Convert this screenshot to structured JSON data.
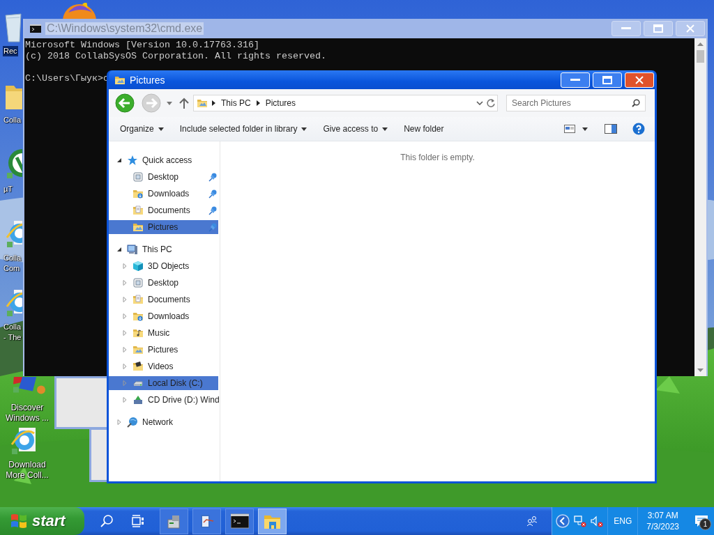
{
  "desktop": {
    "icons": [
      {
        "label_lines": [
          "Rec"
        ],
        "selected": true,
        "kind": "bin"
      },
      {
        "label_lines": [
          "Colla"
        ],
        "selected": false,
        "kind": "folder"
      },
      {
        "label_lines": [
          "µT"
        ],
        "selected": false,
        "kind": "torrent"
      },
      {
        "label_lines": [
          "Colla",
          "Com"
        ],
        "selected": false,
        "kind": "browser"
      },
      {
        "label_lines": [
          "Colla",
          "- The"
        ],
        "selected": false,
        "kind": "browser"
      },
      {
        "label_lines": [
          "Discover",
          "Windows ..."
        ],
        "selected": false,
        "kind": "blocks"
      },
      {
        "label_lines": [
          "Download",
          "More Coll..."
        ],
        "selected": false,
        "kind": "browser"
      }
    ]
  },
  "cmd_window": {
    "title": "C:\\Windows\\system32\\cmd.exe",
    "active": false,
    "output": [
      "Microsoft Windows [Version 10.0.17763.316]",
      "(c) 2018 CollabSysOS Corporation. All rights reserved."
    ],
    "prompt": "C:\\Users\\Гыук>c"
  },
  "explorer": {
    "title": "Pictures",
    "active": true,
    "back_enabled": true,
    "forward_enabled": false,
    "breadcrumbs": [
      "This PC",
      "Pictures"
    ],
    "search": {
      "placeholder": "Search Pictures"
    },
    "commands": [
      {
        "label": "Organize",
        "dropdown": true
      },
      {
        "label": "Include selected folder in library",
        "dropdown": true
      },
      {
        "label": "Give access to",
        "dropdown": true
      },
      {
        "label": "New folder",
        "dropdown": false
      }
    ],
    "nav_tree": [
      {
        "label": "Quick access",
        "kind": "star",
        "expanded": true,
        "selected": false,
        "children": [
          {
            "label": "Desktop",
            "kind": "desktop",
            "pinned": true,
            "selected": false
          },
          {
            "label": "Downloads",
            "kind": "downloads",
            "pinned": true,
            "selected": false
          },
          {
            "label": "Documents",
            "kind": "documents",
            "pinned": true,
            "selected": false
          },
          {
            "label": "Pictures",
            "kind": "pictures",
            "pinned": true,
            "selected": true
          }
        ]
      },
      {
        "label": "This PC",
        "kind": "pc",
        "expanded": true,
        "selected": false,
        "children": [
          {
            "label": "3D Objects",
            "kind": "cube",
            "expanded": false,
            "selected": false
          },
          {
            "label": "Desktop",
            "kind": "desktop",
            "expanded": false,
            "selected": false
          },
          {
            "label": "Documents",
            "kind": "documents",
            "expanded": false,
            "selected": false
          },
          {
            "label": "Downloads",
            "kind": "downloads",
            "expanded": false,
            "selected": false
          },
          {
            "label": "Music",
            "kind": "music",
            "expanded": false,
            "selected": false
          },
          {
            "label": "Pictures",
            "kind": "pictures",
            "expanded": false,
            "selected": false
          },
          {
            "label": "Videos",
            "kind": "videos",
            "expanded": false,
            "selected": false
          },
          {
            "label": "Local Disk (C:)",
            "kind": "disk",
            "expanded": false,
            "selected": true
          },
          {
            "label": "CD Drive (D:) Wind",
            "kind": "cd",
            "expanded": false,
            "selected": false
          }
        ]
      },
      {
        "label": "Network",
        "kind": "net",
        "expanded": false,
        "selected": false
      }
    ],
    "empty_message": "This folder is empty."
  },
  "taskbar": {
    "start_label": "start",
    "apps": [
      {
        "kind": "device",
        "active": false
      },
      {
        "kind": "notepad",
        "active": false
      },
      {
        "kind": "console",
        "active": false
      },
      {
        "kind": "explorer",
        "active": true
      }
    ],
    "tray": {
      "network_error": true,
      "muted": true,
      "language": "ENG",
      "time": "3:07 AM",
      "date": "7/3/2023",
      "notifications": "1"
    }
  }
}
